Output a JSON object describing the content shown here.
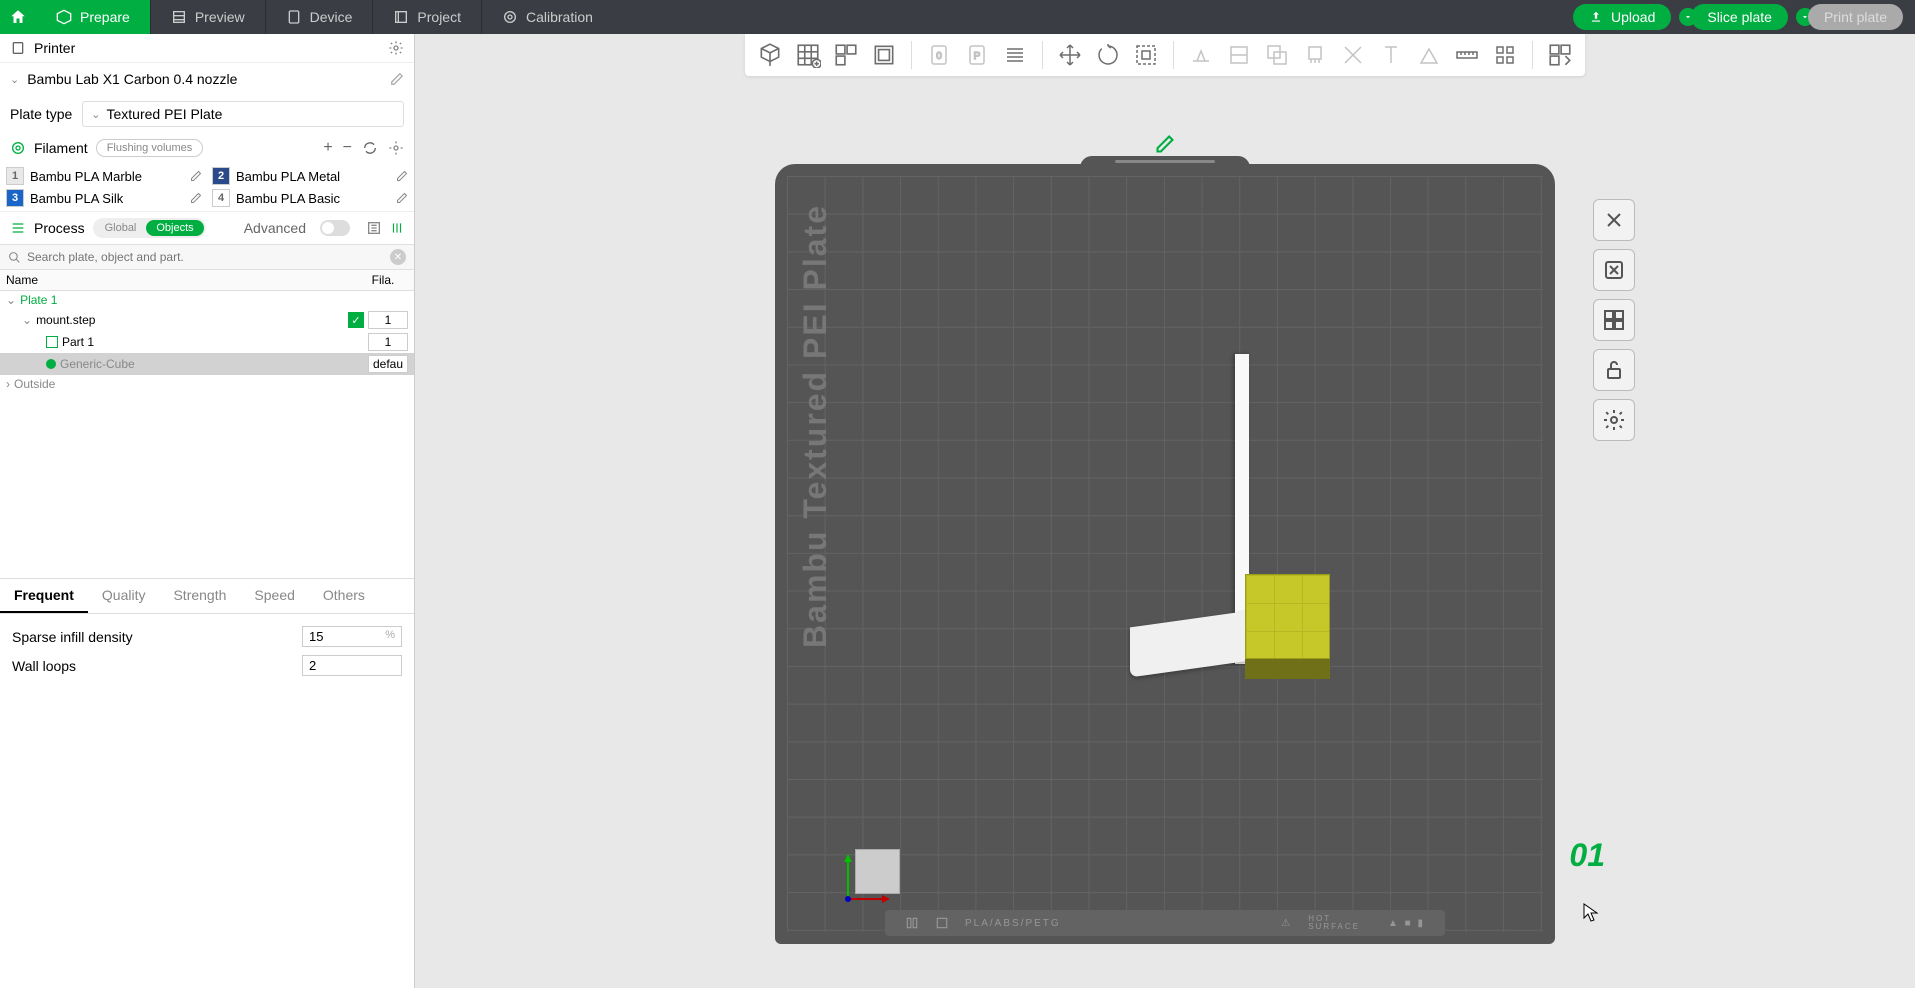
{
  "nav": {
    "prepare": "Prepare",
    "preview": "Preview",
    "device": "Device",
    "project": "Project",
    "calibration": "Calibration"
  },
  "actions": {
    "upload": "Upload",
    "slice": "Slice plate",
    "print": "Print plate"
  },
  "printer": {
    "section": "Printer",
    "name": "Bambu Lab X1 Carbon 0.4 nozzle",
    "plate_type_label": "Plate type",
    "plate_type_value": "Textured PEI Plate"
  },
  "filament": {
    "section": "Filament",
    "flushing": "Flushing volumes",
    "items": [
      {
        "num": "1",
        "name": "Bambu PLA Marble",
        "color": "#e8e8e8"
      },
      {
        "num": "2",
        "name": "Bambu PLA Metal",
        "color": "#2a4a8a"
      },
      {
        "num": "3",
        "name": "Bambu PLA Silk",
        "color": "#1a66c8"
      },
      {
        "num": "4",
        "name": "Bambu PLA Basic",
        "color": "#ffffff"
      }
    ]
  },
  "process": {
    "section": "Process",
    "global": "Global",
    "objects": "Objects",
    "advanced": "Advanced",
    "search_placeholder": "Search plate, object and part.",
    "col_name": "Name",
    "col_fila": "Fila."
  },
  "tree": {
    "plate": "Plate 1",
    "mount": "mount.step",
    "mount_fila": "1",
    "part1": "Part 1",
    "part1_fila": "1",
    "cube": "Generic-Cube",
    "cube_fila": "defau",
    "outside": "Outside"
  },
  "prop_tabs": {
    "frequent": "Frequent",
    "quality": "Quality",
    "strength": "Strength",
    "speed": "Speed",
    "others": "Others"
  },
  "props": {
    "infill_label": "Sparse infill density",
    "infill_value": "15",
    "infill_unit": "%",
    "wall_label": "Wall loops",
    "wall_value": "2"
  },
  "plate3d": {
    "text": "Bambu Textured PEI Plate",
    "number": "01",
    "footer": "PLA/ABS/PETG",
    "hot": "HOT",
    "surface": "SURFACE"
  }
}
